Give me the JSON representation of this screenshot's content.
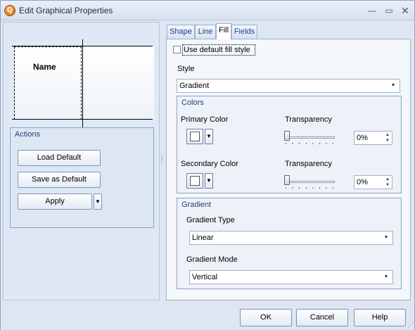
{
  "window": {
    "title": "Edit Graphical Properties",
    "app_icon": "Q",
    "minimize": "—",
    "maximize": "▭",
    "close": "✕"
  },
  "preview": {
    "label": "Name"
  },
  "actions": {
    "title": "Actions",
    "load_default": "Load Default",
    "save_as_default": "Save as Default",
    "apply": "Apply"
  },
  "tabs": [
    {
      "label": "Shape",
      "active": false
    },
    {
      "label": "Line",
      "active": false
    },
    {
      "label": "Fill",
      "active": true
    },
    {
      "label": "Fields",
      "active": false
    }
  ],
  "fill": {
    "use_default_label": "Use default fill style",
    "use_default_checked": false,
    "style_label": "Style",
    "style_value": "Gradient",
    "colors": {
      "title": "Colors",
      "primary_label": "Primary Color",
      "secondary_label": "Secondary Color",
      "transparency_label": "Transparency",
      "primary_color": "#ffffff",
      "secondary_color": "#ffffff",
      "primary_transparency": "0%",
      "secondary_transparency": "0%",
      "primary_transparency_level": 0,
      "secondary_transparency_level": 0
    },
    "gradient": {
      "title": "Gradient",
      "type_label": "Gradient Type",
      "type_value": "Linear",
      "mode_label": "Gradient Mode",
      "mode_value": "Vertical"
    }
  },
  "footer": {
    "ok": "OK",
    "cancel": "Cancel",
    "help": "Help"
  }
}
